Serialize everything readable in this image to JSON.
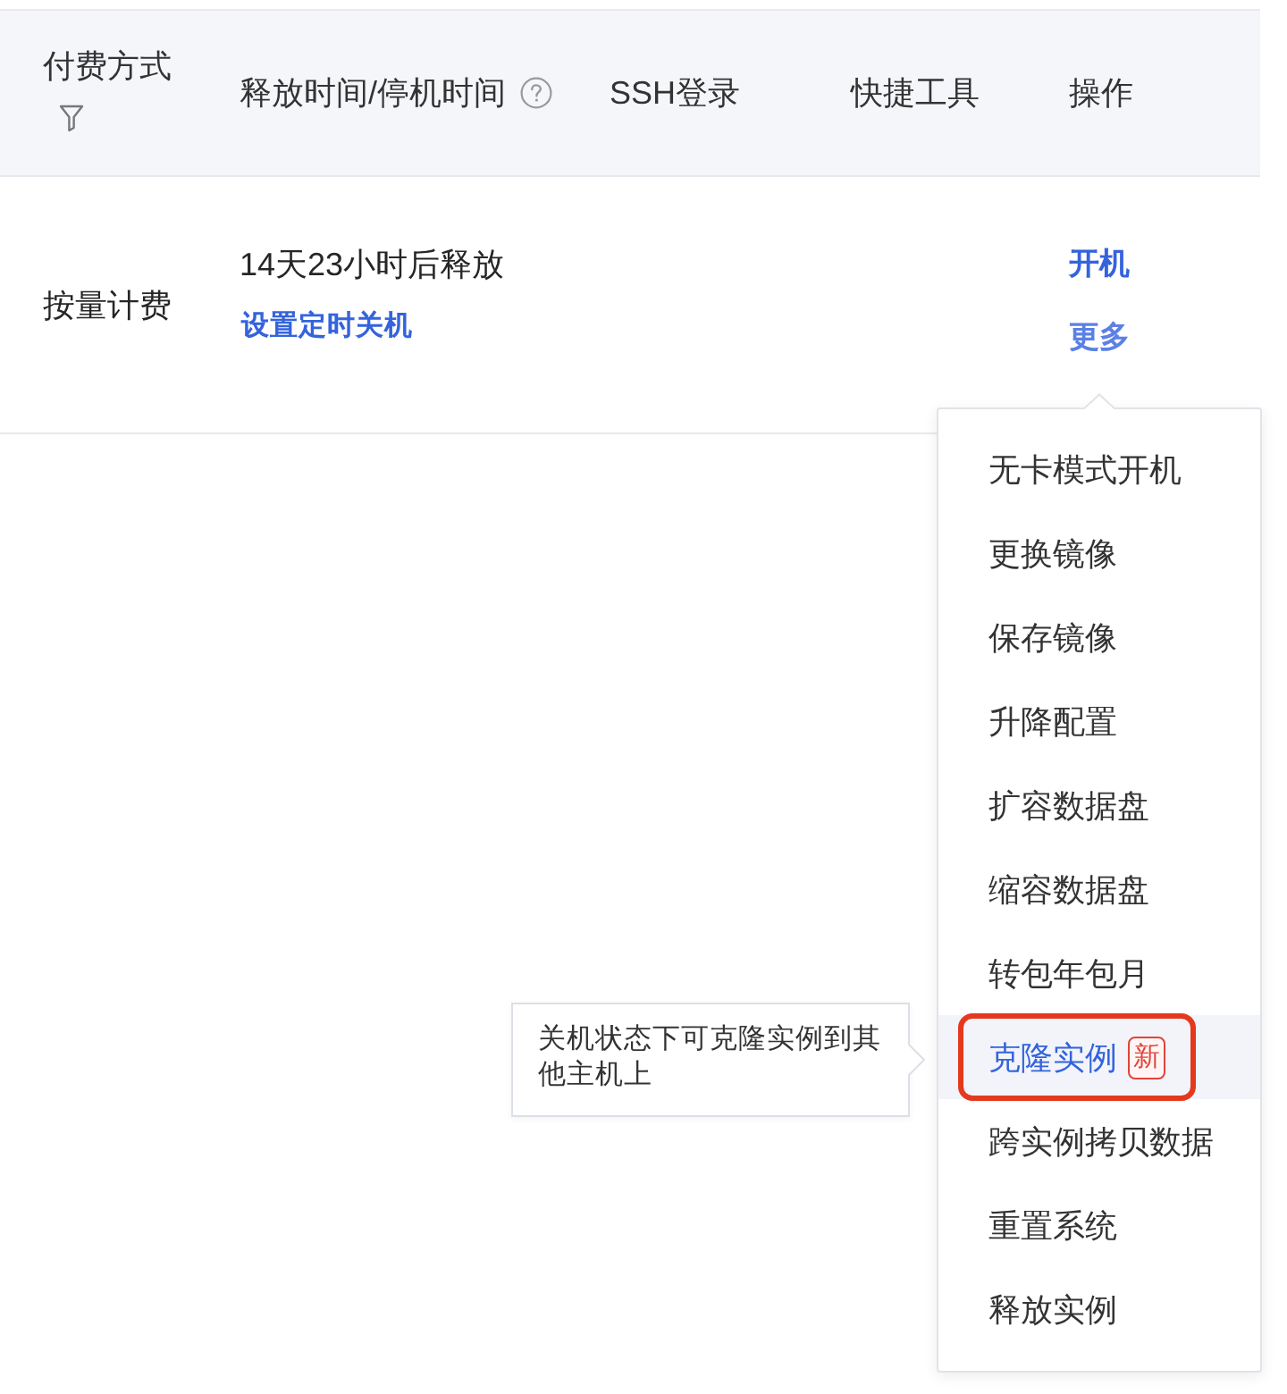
{
  "table": {
    "columns": [
      {
        "label": "付费方式",
        "filterable": true,
        "hint": false
      },
      {
        "label": "释放时间/停机时间",
        "filterable": false,
        "hint": true
      },
      {
        "label": "SSH登录",
        "filterable": false,
        "hint": false
      },
      {
        "label": "快捷工具",
        "filterable": false,
        "hint": false
      },
      {
        "label": "操作",
        "filterable": false,
        "hint": false
      }
    ],
    "rows": [
      {
        "billing": "按量计费",
        "release": {
          "text": "14天23小时后释放",
          "link": "设置定时关机"
        },
        "actions": [
          {
            "label": "开机",
            "active": false
          },
          {
            "label": "更多",
            "active": true
          }
        ]
      }
    ]
  },
  "dropdown": {
    "items": [
      {
        "label": "无卡模式开机",
        "selected": false,
        "outlined": false
      },
      {
        "label": "更换镜像",
        "selected": false,
        "outlined": false
      },
      {
        "label": "保存镜像",
        "selected": false,
        "outlined": false
      },
      {
        "label": "升降配置",
        "selected": false,
        "outlined": false
      },
      {
        "label": "扩容数据盘",
        "selected": false,
        "outlined": false
      },
      {
        "label": "缩容数据盘",
        "selected": false,
        "outlined": false
      },
      {
        "label": "转包年包月",
        "selected": false,
        "outlined": false
      },
      {
        "label": "克隆实例",
        "selected": true,
        "outlined": true,
        "badge": "新"
      },
      {
        "label": "跨实例拷贝数据",
        "selected": false,
        "outlined": false
      },
      {
        "label": "重置系统",
        "selected": false,
        "outlined": false
      },
      {
        "label": "释放实例",
        "selected": false,
        "outlined": false
      }
    ]
  },
  "tooltip": {
    "text": "关机状态下可克隆实例到其他主机上"
  }
}
